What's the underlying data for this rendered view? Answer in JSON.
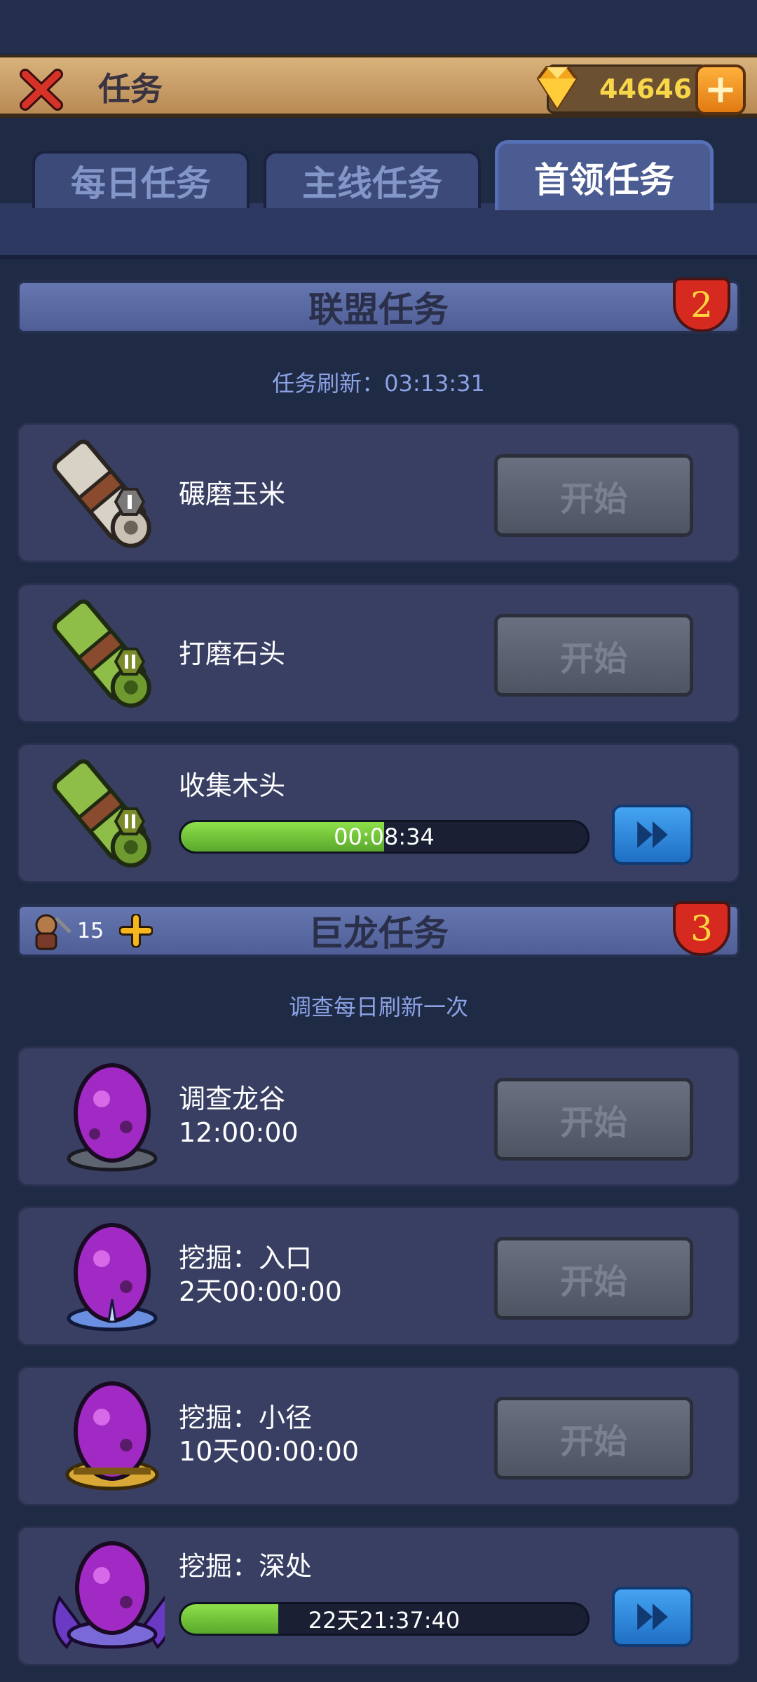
{
  "header": {
    "title": "任务",
    "gems": "44646"
  },
  "tabs": [
    {
      "label": "每日任务",
      "active": false
    },
    {
      "label": "主线任务",
      "active": false
    },
    {
      "label": "首领任务",
      "active": true
    }
  ],
  "alliance": {
    "title": "联盟任务",
    "badge": "2",
    "refresh_label": "任务刷新：03:13:31",
    "tasks": [
      {
        "name": "碾磨玉米",
        "icon": "scroll-gray-I-icon",
        "action": "开始"
      },
      {
        "name": "打磨石头",
        "icon": "scroll-green-II-icon",
        "action": "开始"
      },
      {
        "name": "收集木头",
        "icon": "scroll-green-II-icon",
        "timer": "00:08:34",
        "progress": 0.5
      }
    ]
  },
  "dragon": {
    "title": "巨龙任务",
    "badge": "3",
    "workers": "15",
    "note": "调查每日刷新一次",
    "tasks": [
      {
        "name": "调查龙谷",
        "duration": "12:00:00",
        "action": "开始",
        "icon": "purple-egg-gray-base-icon"
      },
      {
        "name": "挖掘：入口",
        "duration": "2天00:00:00",
        "action": "开始",
        "icon": "purple-egg-blue-base-icon"
      },
      {
        "name": "挖掘：小径",
        "duration": "10天00:00:00",
        "action": "开始",
        "icon": "purple-egg-gold-base-icon"
      },
      {
        "name": "挖掘：深处",
        "timer": "22天21:37:40",
        "progress": 0.24,
        "icon": "purple-egg-winged-icon"
      }
    ]
  },
  "colors": {
    "accent_gold": "#f8d64a",
    "progress_green": "#7ad03c",
    "badge_red": "#d6291f",
    "ff_blue": "#2f86dc"
  }
}
